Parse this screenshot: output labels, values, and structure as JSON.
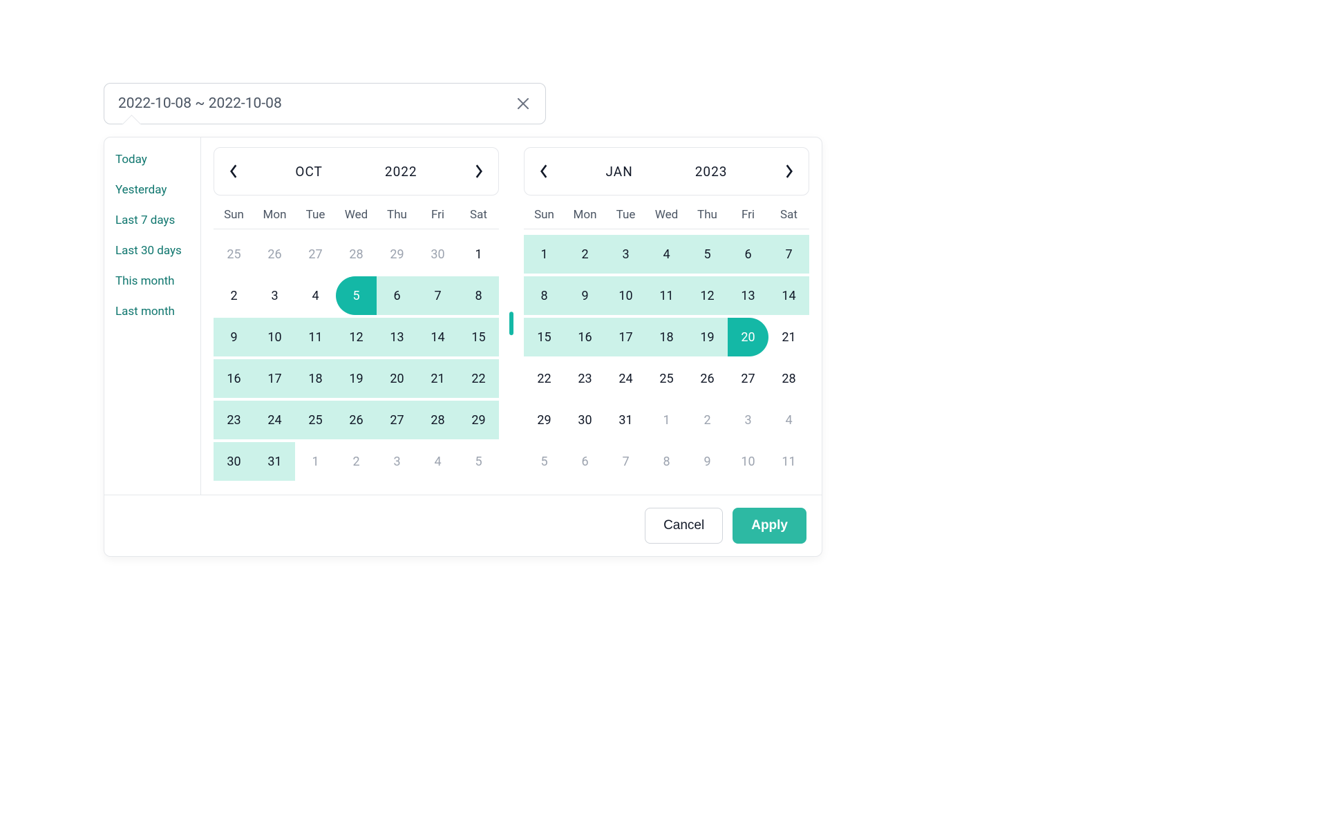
{
  "input": {
    "value": "2022-10-08 ~ 2022-10-08"
  },
  "presets": [
    "Today",
    "Yesterday",
    "Last 7 days",
    "Last 30 days",
    "This month",
    "Last month"
  ],
  "weekdays": [
    "Sun",
    "Mon",
    "Tue",
    "Wed",
    "Thu",
    "Fri",
    "Sat"
  ],
  "left": {
    "month": "OCT",
    "year": "2022",
    "days": [
      {
        "d": 25,
        "outside": true
      },
      {
        "d": 26,
        "outside": true
      },
      {
        "d": 27,
        "outside": true
      },
      {
        "d": 28,
        "outside": true
      },
      {
        "d": 29,
        "outside": true
      },
      {
        "d": 30,
        "outside": true
      },
      {
        "d": 1
      },
      {
        "d": 2
      },
      {
        "d": 3
      },
      {
        "d": 4
      },
      {
        "d": 5,
        "start": true
      },
      {
        "d": 6,
        "inRange": true
      },
      {
        "d": 7,
        "inRange": true
      },
      {
        "d": 8,
        "inRange": true
      },
      {
        "d": 9,
        "inRange": true
      },
      {
        "d": 10,
        "inRange": true
      },
      {
        "d": 11,
        "inRange": true
      },
      {
        "d": 12,
        "inRange": true
      },
      {
        "d": 13,
        "inRange": true
      },
      {
        "d": 14,
        "inRange": true
      },
      {
        "d": 15,
        "inRange": true
      },
      {
        "d": 16,
        "inRange": true
      },
      {
        "d": 17,
        "inRange": true
      },
      {
        "d": 18,
        "inRange": true
      },
      {
        "d": 19,
        "inRange": true
      },
      {
        "d": 20,
        "inRange": true
      },
      {
        "d": 21,
        "inRange": true
      },
      {
        "d": 22,
        "inRange": true
      },
      {
        "d": 23,
        "inRange": true
      },
      {
        "d": 24,
        "inRange": true
      },
      {
        "d": 25,
        "inRange": true
      },
      {
        "d": 26,
        "inRange": true
      },
      {
        "d": 27,
        "inRange": true
      },
      {
        "d": 28,
        "inRange": true
      },
      {
        "d": 29,
        "inRange": true
      },
      {
        "d": 30,
        "inRange": true
      },
      {
        "d": 31,
        "inRange": true
      },
      {
        "d": 1,
        "outside": true
      },
      {
        "d": 2,
        "outside": true
      },
      {
        "d": 3,
        "outside": true
      },
      {
        "d": 4,
        "outside": true
      },
      {
        "d": 5,
        "outside": true
      }
    ]
  },
  "right": {
    "month": "JAN",
    "year": "2023",
    "days": [
      {
        "d": 1,
        "inRange": true
      },
      {
        "d": 2,
        "inRange": true
      },
      {
        "d": 3,
        "inRange": true
      },
      {
        "d": 4,
        "inRange": true
      },
      {
        "d": 5,
        "inRange": true
      },
      {
        "d": 6,
        "inRange": true
      },
      {
        "d": 7,
        "inRange": true
      },
      {
        "d": 8,
        "inRange": true
      },
      {
        "d": 9,
        "inRange": true
      },
      {
        "d": 10,
        "inRange": true
      },
      {
        "d": 11,
        "inRange": true
      },
      {
        "d": 12,
        "inRange": true
      },
      {
        "d": 13,
        "inRange": true
      },
      {
        "d": 14,
        "inRange": true
      },
      {
        "d": 15,
        "inRange": true
      },
      {
        "d": 16,
        "inRange": true
      },
      {
        "d": 17,
        "inRange": true
      },
      {
        "d": 18,
        "inRange": true
      },
      {
        "d": 19,
        "inRange": true
      },
      {
        "d": 20,
        "end": true
      },
      {
        "d": 21
      },
      {
        "d": 22
      },
      {
        "d": 23
      },
      {
        "d": 24
      },
      {
        "d": 25
      },
      {
        "d": 26
      },
      {
        "d": 27
      },
      {
        "d": 28
      },
      {
        "d": 29
      },
      {
        "d": 30
      },
      {
        "d": 31
      },
      {
        "d": 1,
        "outside": true
      },
      {
        "d": 2,
        "outside": true
      },
      {
        "d": 3,
        "outside": true
      },
      {
        "d": 4,
        "outside": true
      },
      {
        "d": 5,
        "outside": true
      },
      {
        "d": 6,
        "outside": true
      },
      {
        "d": 7,
        "outside": true
      },
      {
        "d": 8,
        "outside": true
      },
      {
        "d": 9,
        "outside": true
      },
      {
        "d": 10,
        "outside": true
      },
      {
        "d": 11,
        "outside": true
      }
    ]
  },
  "actions": {
    "cancel": "Cancel",
    "apply": "Apply"
  }
}
